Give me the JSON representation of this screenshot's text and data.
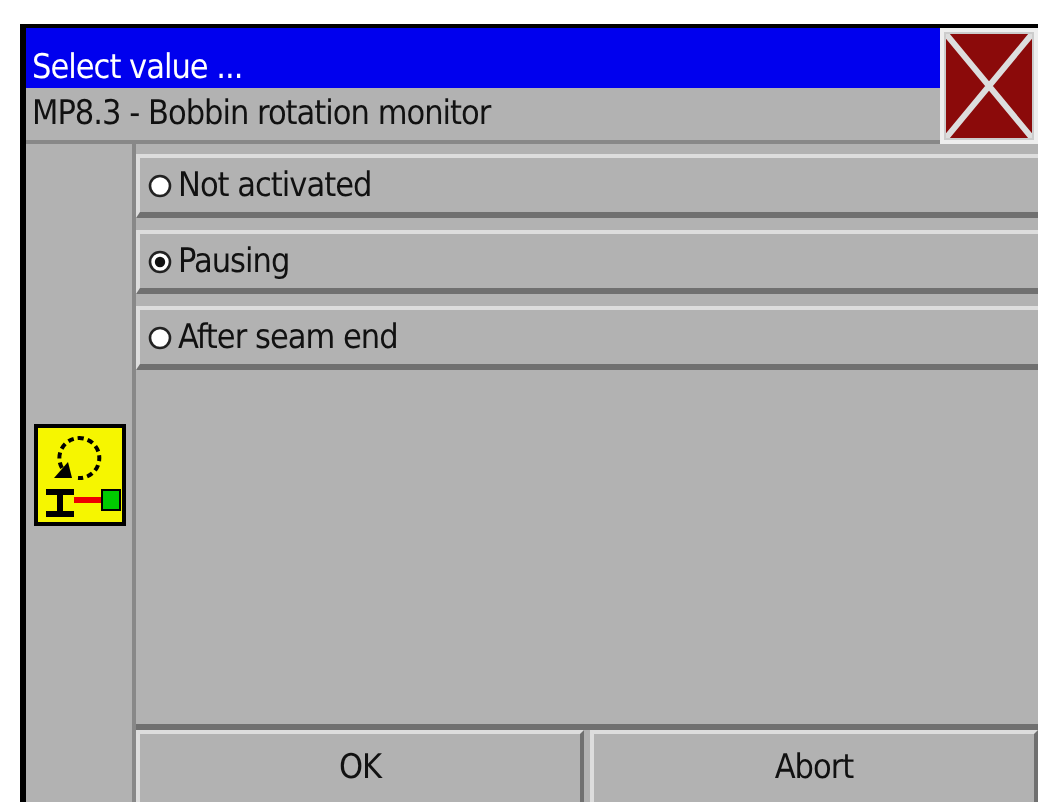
{
  "window": {
    "title": "Select value ..."
  },
  "parameter": {
    "label": "MP8.3 - Bobbin rotation monitor"
  },
  "options": [
    {
      "label": "Not activated",
      "selected": false
    },
    {
      "label": "Pausing",
      "selected": true
    },
    {
      "label": "After seam end",
      "selected": false
    }
  ],
  "buttons": [
    {
      "label": "OK"
    },
    {
      "label": "Abort"
    }
  ]
}
